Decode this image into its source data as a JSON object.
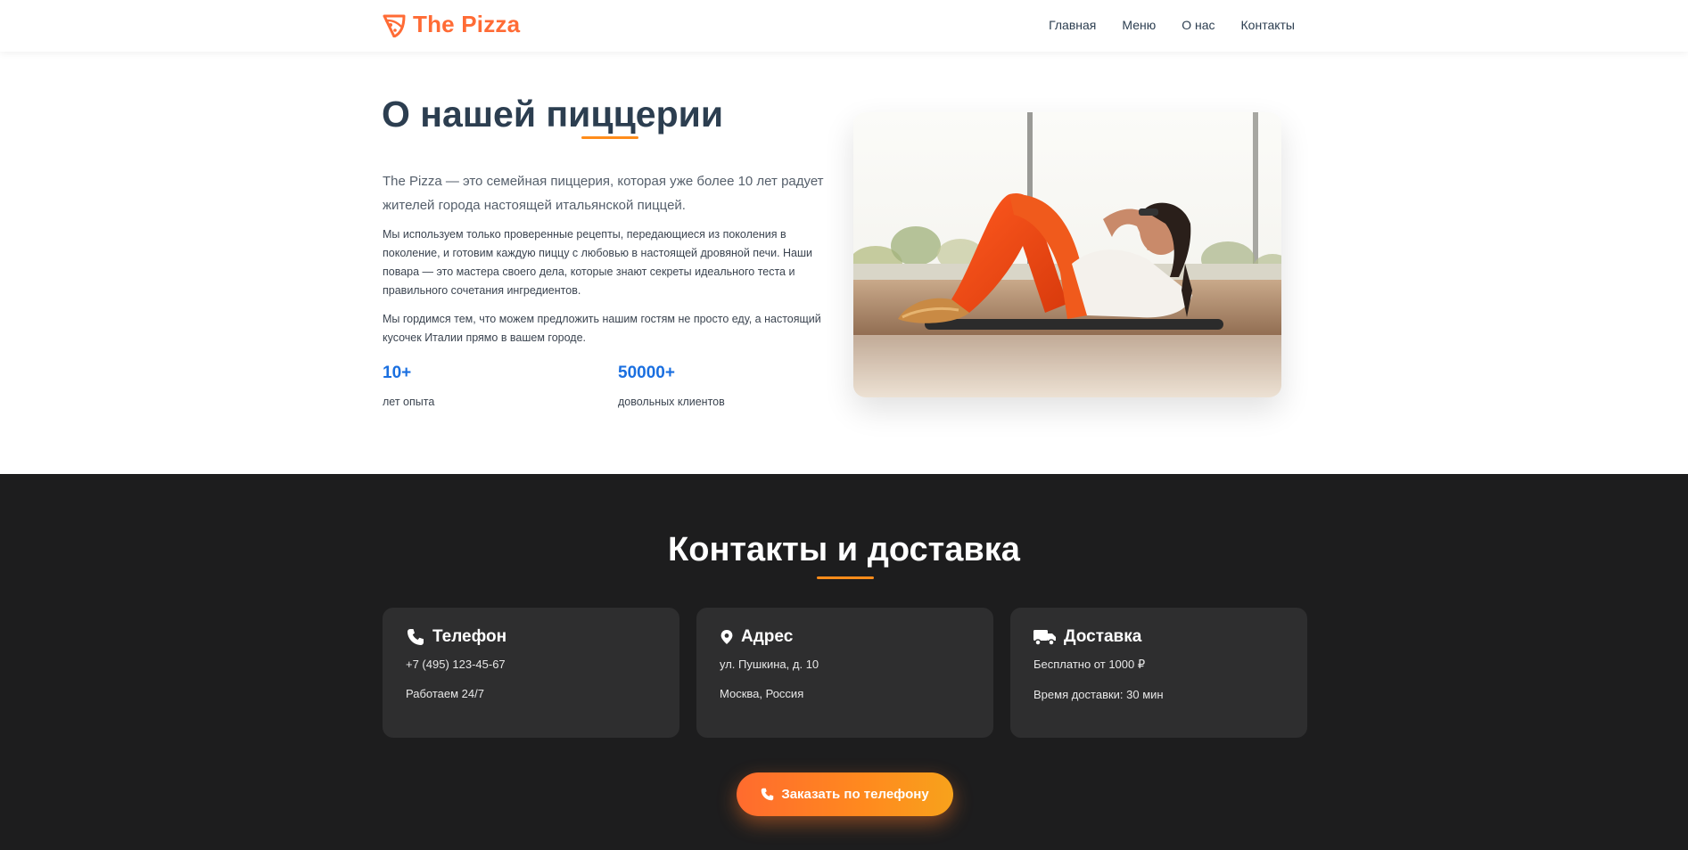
{
  "header": {
    "logo_text": "The Pizza",
    "logo_icon": "pizza-slice-icon",
    "nav": [
      {
        "label": "Главная"
      },
      {
        "label": "Меню"
      },
      {
        "label": "О нас"
      },
      {
        "label": "Контакты"
      }
    ]
  },
  "about": {
    "title": "О нашей пиццерии",
    "lead": "The Pizza — это семейная пиццерия, которая уже более 10 лет радует жителей города настоящей итальянской пиццей.",
    "paragraph1": "Мы используем только проверенные рецепты, передающиеся из поколения в поколение, и готовим каждую пиццу с любовью в настоящей дровяной печи. Наши повара — это мастера своего дела, которые знают секреты идеального теста и правильного сочетания ингредиентов.",
    "paragraph2": "Мы гордимся тем, что можем предложить нашим гостям не просто еду, а настоящий кусочек Италии прямо в вашем городе.",
    "stats": [
      {
        "value": "10+",
        "label": "лет опыта"
      },
      {
        "value": "50000+",
        "label": "довольных клиентов"
      }
    ]
  },
  "contacts": {
    "title": "Контакты и доставка",
    "cards": [
      {
        "icon": "phone-icon",
        "title": "Телефон",
        "line1": "+7 (495) 123-45-67",
        "line2": "Работаем 24/7"
      },
      {
        "icon": "map-pin-icon",
        "title": "Адрес",
        "line1": "ул. Пушкина, д. 10",
        "line2": "Москва, Россия"
      },
      {
        "icon": "truck-icon",
        "title": "Доставка",
        "line1": "Бесплатно от 1000 ₽",
        "line2": "Время доставки: 30 мин"
      }
    ],
    "order_button": {
      "icon": "phone-icon",
      "label": "Заказать по телефону"
    }
  },
  "colors": {
    "accent": "#ff6b35",
    "stat_blue": "#1a6fe0",
    "dark_bg": "#1d1d1e",
    "card_bg": "#2e2e2f"
  }
}
